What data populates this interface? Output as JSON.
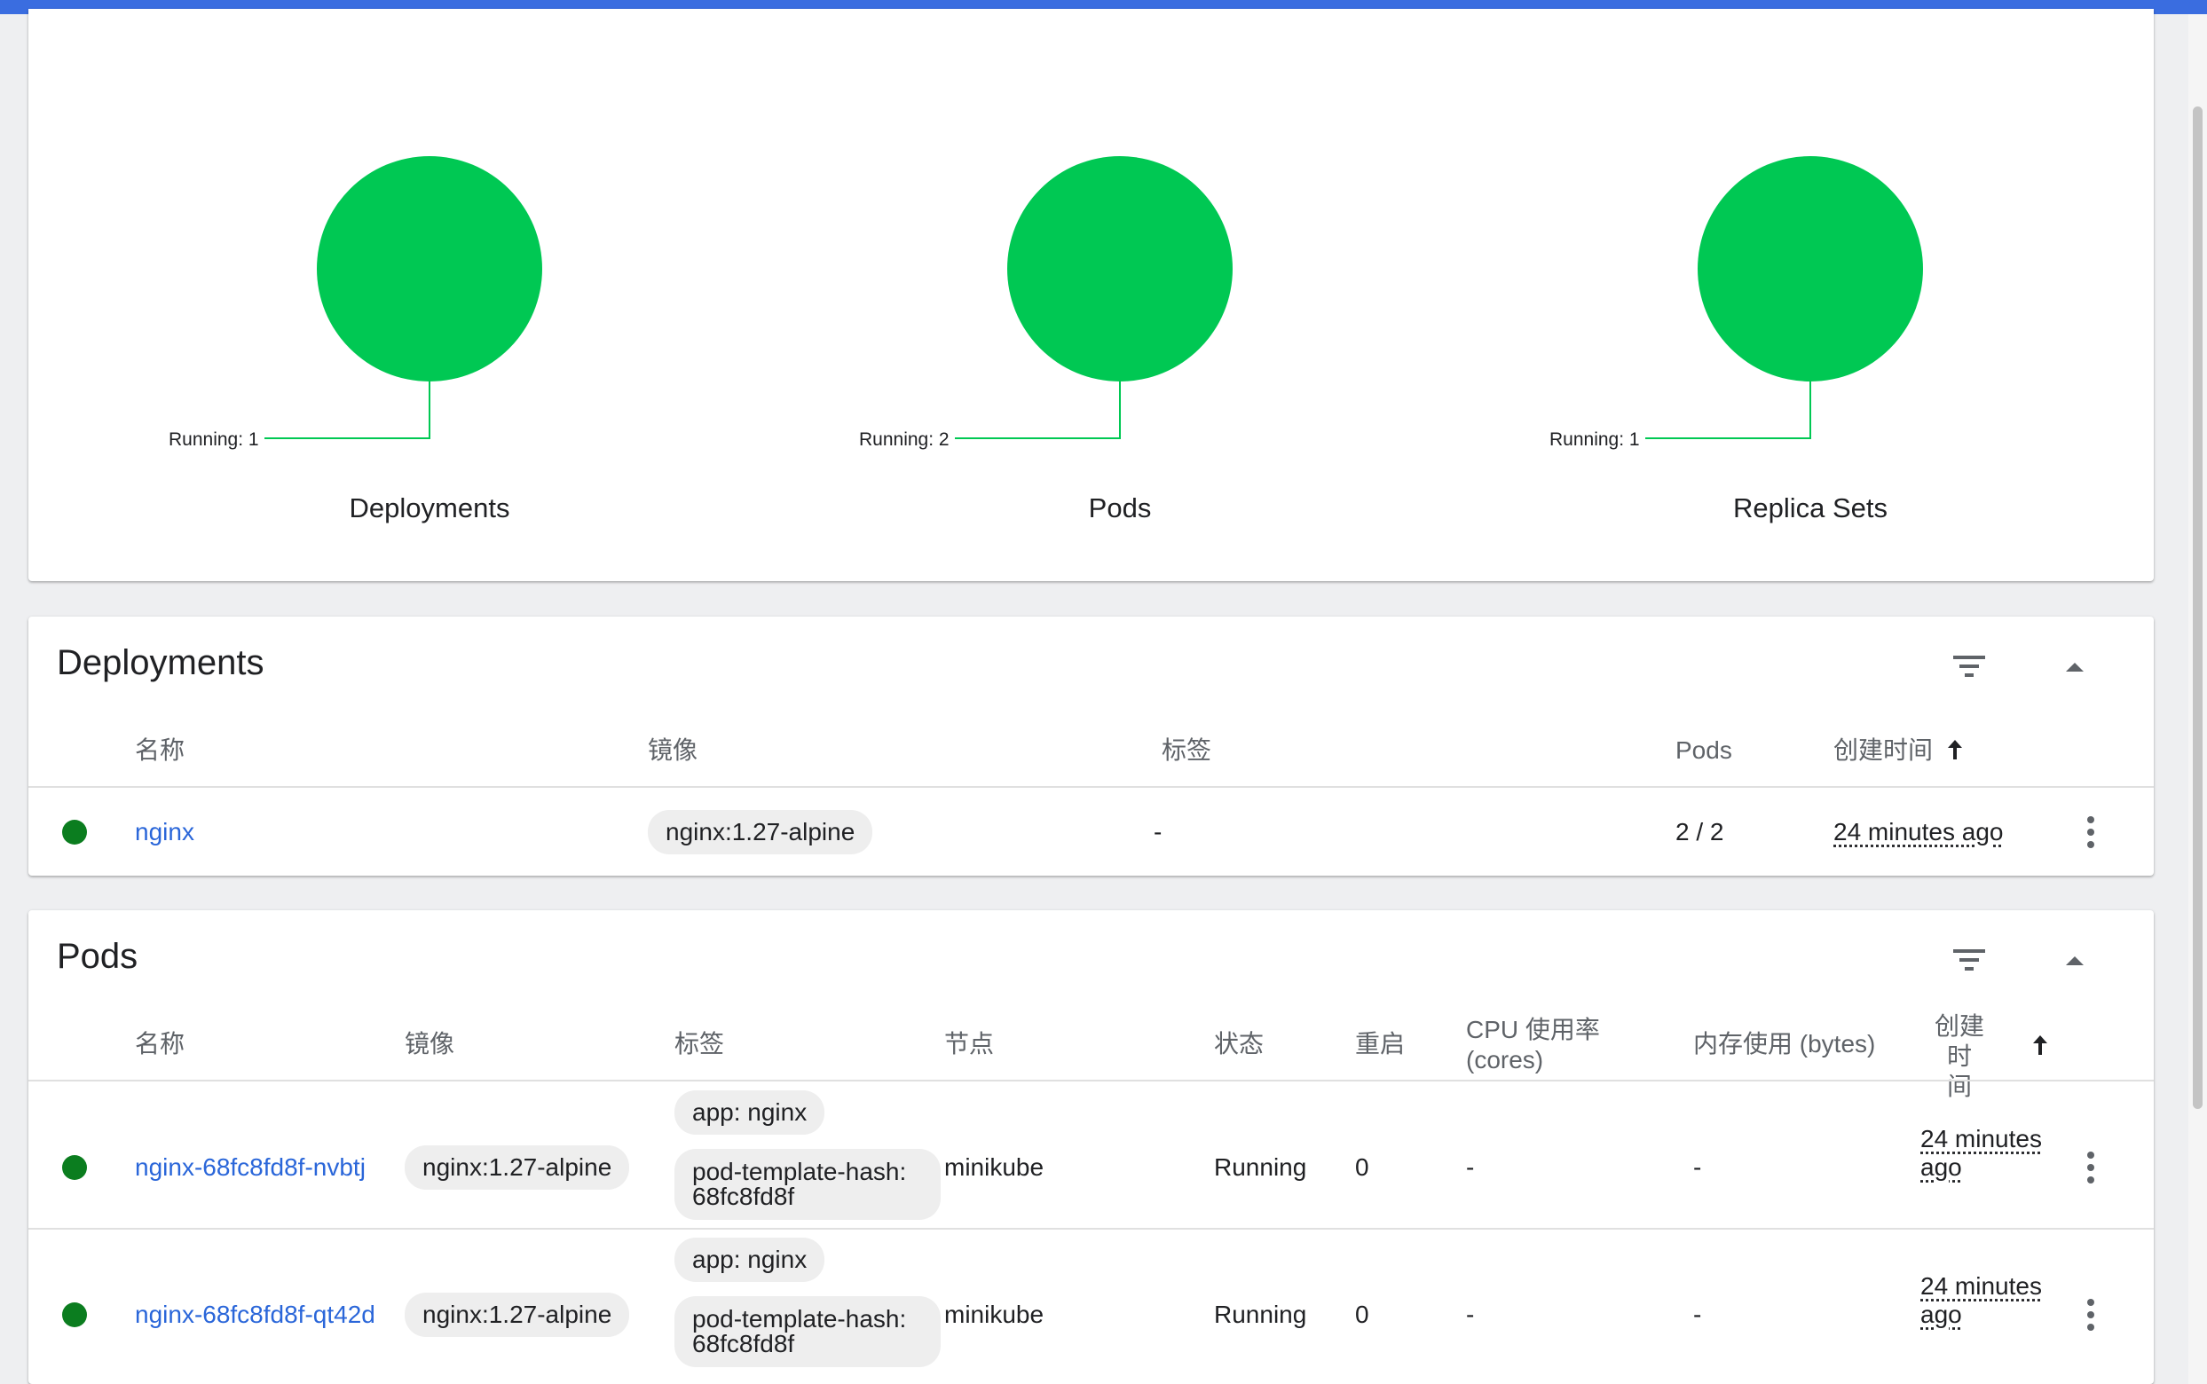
{
  "summary": {
    "charts": [
      {
        "title": "Deployments",
        "label": "Running: 1"
      },
      {
        "title": "Pods",
        "label": "Running: 2"
      },
      {
        "title": "Replica Sets",
        "label": "Running: 1"
      }
    ],
    "running_color": "#00c853"
  },
  "deployments": {
    "title": "Deployments",
    "headers": {
      "name": "名称",
      "image": "镜像",
      "labels": "标签",
      "pods": "Pods",
      "created": "创建时间"
    },
    "rows": [
      {
        "name": "nginx",
        "image": "nginx:1.27-alpine",
        "labels": "-",
        "pods": "2 / 2",
        "created": "24 minutes ago"
      }
    ]
  },
  "pods": {
    "title": "Pods",
    "headers": {
      "name": "名称",
      "image": "镜像",
      "labels": "标签",
      "node": "节点",
      "status": "状态",
      "restarts": "重启",
      "cpu_line1": "CPU 使用率",
      "cpu_line2": "(cores)",
      "memory": "内存使用 (bytes)",
      "created_line1": "创建时",
      "created_line2": "间"
    },
    "rows": [
      {
        "name": "nginx-68fc8fd8f-nvbtj",
        "image": "nginx:1.27-alpine",
        "label1": "app: nginx",
        "label2": "pod-template-hash: 68fc8fd8f",
        "node": "minikube",
        "status": "Running",
        "restarts": "0",
        "cpu": "-",
        "memory": "-",
        "created_line1": "24 minutes",
        "created_line2": "ago"
      },
      {
        "name": "nginx-68fc8fd8f-qt42d",
        "image": "nginx:1.27-alpine",
        "label1": "app: nginx",
        "label2": "pod-template-hash: 68fc8fd8f",
        "node": "minikube",
        "status": "Running",
        "restarts": "0",
        "cpu": "-",
        "memory": "-",
        "created_line1": "24 minutes",
        "created_line2": "ago"
      }
    ]
  },
  "icons": {
    "filter": "filter-icon",
    "collapse": "chevron-up-icon",
    "sort": "arrow-up-icon",
    "more": "more-vert-icon",
    "status": "status-dot-icon"
  }
}
